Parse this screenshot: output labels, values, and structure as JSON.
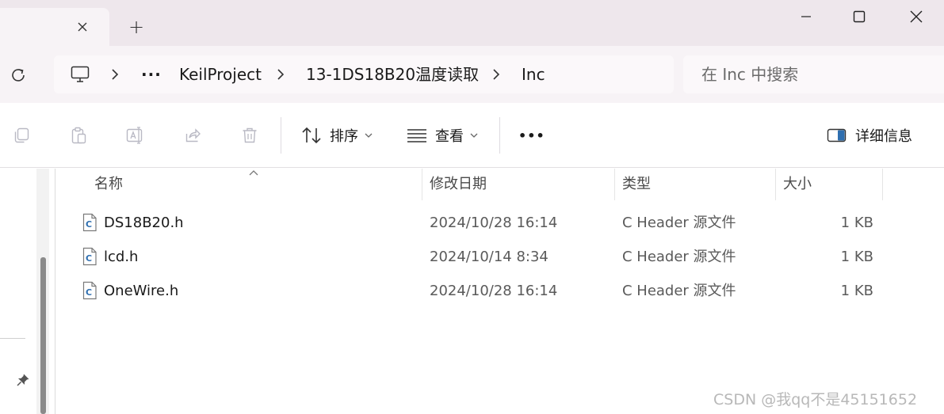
{
  "titlebar": {
    "new_tab_label": "+"
  },
  "address": {
    "crumbs": [
      "KeilProject",
      "13-1DS18B20温度读取",
      "Inc"
    ],
    "more_label": "···"
  },
  "search": {
    "placeholder": "在 Inc 中搜索"
  },
  "toolbar": {
    "sort_label": "排序",
    "view_label": "查看",
    "more_label": "•••",
    "details_label": "详细信息"
  },
  "columns": {
    "name": "名称",
    "date": "修改日期",
    "type": "类型",
    "size": "大小"
  },
  "files": [
    {
      "name": "DS18B20.h",
      "date": "2024/10/28 16:14",
      "type": "C Header 源文件",
      "size": "1 KB"
    },
    {
      "name": "lcd.h",
      "date": "2024/10/14 8:34",
      "type": "C Header 源文件",
      "size": "1 KB"
    },
    {
      "name": "OneWire.h",
      "date": "2024/10/28 16:14",
      "type": "C Header 源文件",
      "size": "1 KB"
    }
  ],
  "watermark": "CSDN @我qq不是45151652",
  "colors": {
    "titlebar_bg": "#eee7ec",
    "address_bg": "#f7f3f6",
    "file_icon_blue": "#2f6fb0"
  },
  "icons": {
    "tab_close": "close-icon",
    "refresh": "refresh-icon",
    "computer": "monitor-icon",
    "copy": "copy-icon",
    "paste": "paste-icon",
    "rename": "rename-icon",
    "share": "share-icon",
    "delete": "trash-icon",
    "sort": "sort-icon",
    "view": "view-list-icon",
    "details": "details-pane-icon",
    "pin": "pin-icon",
    "file": "c-header-file-icon"
  }
}
